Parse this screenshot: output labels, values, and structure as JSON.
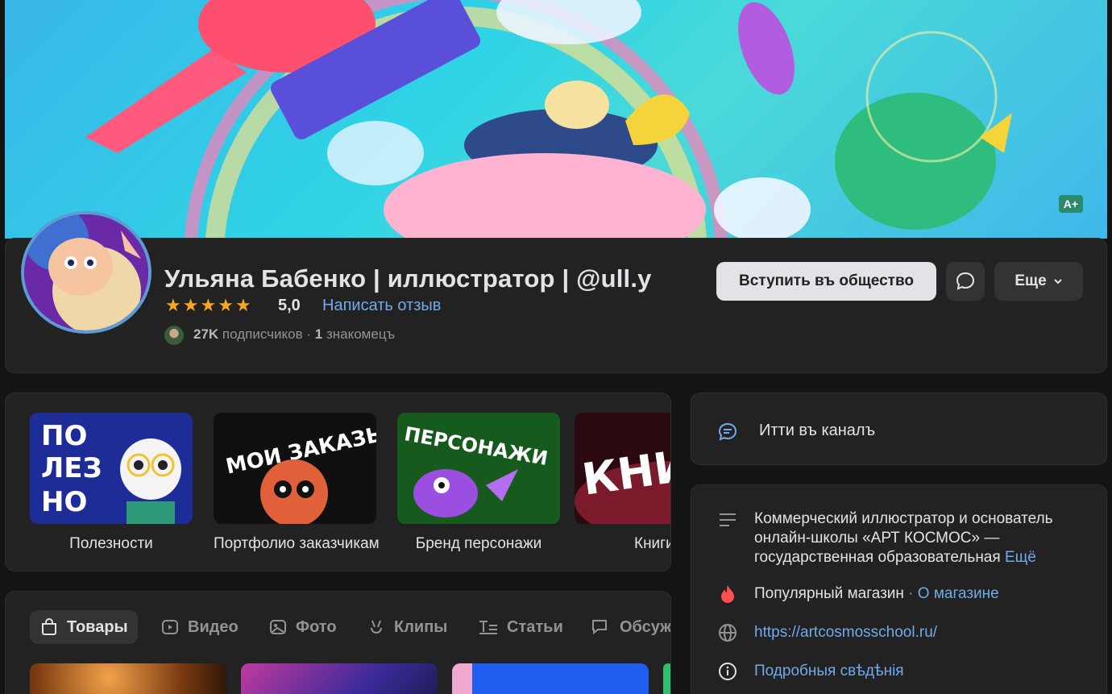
{
  "cover": {
    "badge": "A+"
  },
  "profile": {
    "name": "Ульяна Бабенко | иллюстратор | @ull.y",
    "rating": "5,0",
    "review_link": "Написать отзыв",
    "subscribers_count": "27K",
    "subscribers_word": "подписчиков",
    "dot": "·",
    "friends_count": "1",
    "friends_word": "знакомецъ",
    "stars": 5
  },
  "actions": {
    "join": "Вступить въ общество",
    "more": "Еще"
  },
  "collections": [
    {
      "label": "Полезности",
      "thumb_text": "ПО ЛЕЗ НО"
    },
    {
      "label": "Портфолио заказчикам",
      "thumb_text": "МОИ ЗАКАЗЫ"
    },
    {
      "label": "Бренд персонажи",
      "thumb_text": "ПЕРСОНАЖИ"
    },
    {
      "label": "Книги",
      "thumb_text": "КНИ"
    }
  ],
  "tabs": [
    {
      "label": "Товары",
      "icon": "bag-icon",
      "active": true
    },
    {
      "label": "Видео",
      "icon": "video-icon",
      "active": false
    },
    {
      "label": "Фото",
      "icon": "photo-icon",
      "active": false
    },
    {
      "label": "Клипы",
      "icon": "clips-icon",
      "active": false
    },
    {
      "label": "Статьи",
      "icon": "articles-icon",
      "active": false
    },
    {
      "label": "Обсуж",
      "icon": "discussions-icon",
      "active": false
    }
  ],
  "channel": {
    "label": "Итти въ каналъ"
  },
  "info": {
    "description": "Коммерческий иллюстратор и основатель онлайн-школы «АРТ КОСМОС» — государственная образовательная",
    "description_more": "Ещё",
    "shop_label": "Популярный магазин",
    "shop_sep": "·",
    "shop_link": "О магазине",
    "website": "https://artcosmosschool.ru/",
    "details": "Подробныя свѣдѣнія"
  },
  "colors": {
    "accent": "#71aaeb",
    "background": "#141414",
    "card": "#222222",
    "star": "#f5a623"
  }
}
